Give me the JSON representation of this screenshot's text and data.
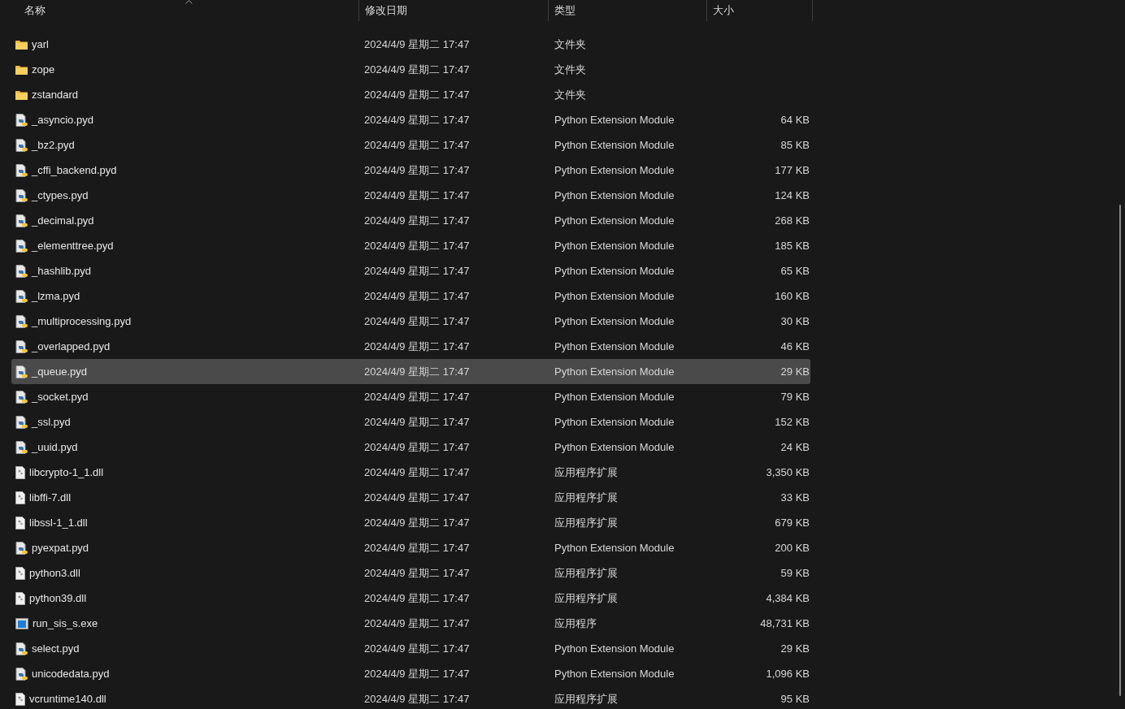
{
  "columns": [
    {
      "label": "名称",
      "sorted": true
    },
    {
      "label": "修改日期",
      "sorted": false
    },
    {
      "label": "类型",
      "sorted": false
    },
    {
      "label": "大小",
      "sorted": false
    }
  ],
  "rows": [
    {
      "kind": "folder",
      "name": "yarl",
      "date": "2024/4/9 星期二 17:47",
      "type": "文件夹",
      "size": "",
      "selected": false
    },
    {
      "kind": "folder",
      "name": "zope",
      "date": "2024/4/9 星期二 17:47",
      "type": "文件夹",
      "size": "",
      "selected": false
    },
    {
      "kind": "folder",
      "name": "zstandard",
      "date": "2024/4/9 星期二 17:47",
      "type": "文件夹",
      "size": "",
      "selected": false
    },
    {
      "kind": "pyd",
      "name": "_asyncio.pyd",
      "date": "2024/4/9 星期二 17:47",
      "type": "Python Extension Module",
      "size": "64 KB",
      "selected": false
    },
    {
      "kind": "pyd",
      "name": "_bz2.pyd",
      "date": "2024/4/9 星期二 17:47",
      "type": "Python Extension Module",
      "size": "85 KB",
      "selected": false
    },
    {
      "kind": "pyd",
      "name": "_cffi_backend.pyd",
      "date": "2024/4/9 星期二 17:47",
      "type": "Python Extension Module",
      "size": "177 KB",
      "selected": false
    },
    {
      "kind": "pyd",
      "name": "_ctypes.pyd",
      "date": "2024/4/9 星期二 17:47",
      "type": "Python Extension Module",
      "size": "124 KB",
      "selected": false
    },
    {
      "kind": "pyd",
      "name": "_decimal.pyd",
      "date": "2024/4/9 星期二 17:47",
      "type": "Python Extension Module",
      "size": "268 KB",
      "selected": false
    },
    {
      "kind": "pyd",
      "name": "_elementtree.pyd",
      "date": "2024/4/9 星期二 17:47",
      "type": "Python Extension Module",
      "size": "185 KB",
      "selected": false
    },
    {
      "kind": "pyd",
      "name": "_hashlib.pyd",
      "date": "2024/4/9 星期二 17:47",
      "type": "Python Extension Module",
      "size": "65 KB",
      "selected": false
    },
    {
      "kind": "pyd",
      "name": "_lzma.pyd",
      "date": "2024/4/9 星期二 17:47",
      "type": "Python Extension Module",
      "size": "160 KB",
      "selected": false
    },
    {
      "kind": "pyd",
      "name": "_multiprocessing.pyd",
      "date": "2024/4/9 星期二 17:47",
      "type": "Python Extension Module",
      "size": "30 KB",
      "selected": false
    },
    {
      "kind": "pyd",
      "name": "_overlapped.pyd",
      "date": "2024/4/9 星期二 17:47",
      "type": "Python Extension Module",
      "size": "46 KB",
      "selected": false
    },
    {
      "kind": "pyd",
      "name": "_queue.pyd",
      "date": "2024/4/9 星期二 17:47",
      "type": "Python Extension Module",
      "size": "29 KB",
      "selected": true
    },
    {
      "kind": "pyd",
      "name": "_socket.pyd",
      "date": "2024/4/9 星期二 17:47",
      "type": "Python Extension Module",
      "size": "79 KB",
      "selected": false
    },
    {
      "kind": "pyd",
      "name": "_ssl.pyd",
      "date": "2024/4/9 星期二 17:47",
      "type": "Python Extension Module",
      "size": "152 KB",
      "selected": false
    },
    {
      "kind": "pyd",
      "name": "_uuid.pyd",
      "date": "2024/4/9 星期二 17:47",
      "type": "Python Extension Module",
      "size": "24 KB",
      "selected": false
    },
    {
      "kind": "dll",
      "name": "libcrypto-1_1.dll",
      "date": "2024/4/9 星期二 17:47",
      "type": "应用程序扩展",
      "size": "3,350 KB",
      "selected": false
    },
    {
      "kind": "dll",
      "name": "libffi-7.dll",
      "date": "2024/4/9 星期二 17:47",
      "type": "应用程序扩展",
      "size": "33 KB",
      "selected": false
    },
    {
      "kind": "dll",
      "name": "libssl-1_1.dll",
      "date": "2024/4/9 星期二 17:47",
      "type": "应用程序扩展",
      "size": "679 KB",
      "selected": false
    },
    {
      "kind": "pyd",
      "name": "pyexpat.pyd",
      "date": "2024/4/9 星期二 17:47",
      "type": "Python Extension Module",
      "size": "200 KB",
      "selected": false
    },
    {
      "kind": "dll",
      "name": "python3.dll",
      "date": "2024/4/9 星期二 17:47",
      "type": "应用程序扩展",
      "size": "59 KB",
      "selected": false
    },
    {
      "kind": "dll",
      "name": "python39.dll",
      "date": "2024/4/9 星期二 17:47",
      "type": "应用程序扩展",
      "size": "4,384 KB",
      "selected": false
    },
    {
      "kind": "exe",
      "name": "run_sis_s.exe",
      "date": "2024/4/9 星期二 17:47",
      "type": "应用程序",
      "size": "48,731 KB",
      "selected": false
    },
    {
      "kind": "pyd",
      "name": "select.pyd",
      "date": "2024/4/9 星期二 17:47",
      "type": "Python Extension Module",
      "size": "29 KB",
      "selected": false
    },
    {
      "kind": "pyd",
      "name": "unicodedata.pyd",
      "date": "2024/4/9 星期二 17:47",
      "type": "Python Extension Module",
      "size": "1,096 KB",
      "selected": false
    },
    {
      "kind": "dll",
      "name": "vcruntime140.dll",
      "date": "2024/4/9 星期二 17:47",
      "type": "应用程序扩展",
      "size": "95 KB",
      "selected": false
    }
  ]
}
